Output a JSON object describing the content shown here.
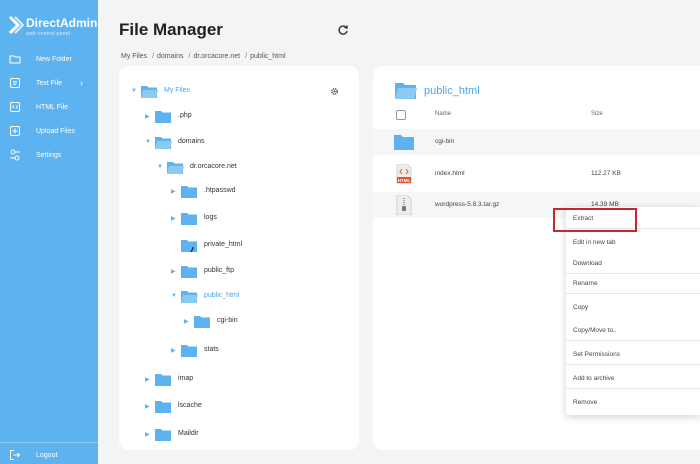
{
  "app": {
    "brand": "DirectAdmin",
    "brand_sub": "web control panel",
    "accent": "#5cb3ef"
  },
  "sidebar": {
    "items": [
      {
        "label": "New Folder",
        "icon": "folder-outline-icon"
      },
      {
        "label": "Text File",
        "icon": "text-file-icon",
        "chevron": "›"
      },
      {
        "label": "HTML File",
        "icon": "html-file-icon"
      },
      {
        "label": "Upload Files",
        "icon": "upload-icon"
      },
      {
        "label": "Settings",
        "icon": "settings-sliders-icon"
      }
    ],
    "logout": "Logout"
  },
  "header": {
    "title": "File Manager",
    "breadcrumb": [
      "My Files",
      "domains",
      "dr.orcacore.net",
      "public_html"
    ]
  },
  "tree": {
    "root": "My Files",
    "nodes": [
      {
        "name": ".php"
      },
      {
        "name": "domains"
      },
      {
        "name": "dr.orcacore.net"
      },
      {
        "name": ".htpasswd"
      },
      {
        "name": "logs"
      },
      {
        "name": "private_html"
      },
      {
        "name": "public_ftp"
      },
      {
        "name": "public_html"
      },
      {
        "name": "cgi-bin"
      },
      {
        "name": "stats"
      },
      {
        "name": "imap"
      },
      {
        "name": "lscache"
      },
      {
        "name": "Maildir"
      }
    ]
  },
  "files": {
    "title": "public_html",
    "columns": {
      "name": "Name",
      "size": "Size"
    },
    "rows": [
      {
        "name": "cgi-bin",
        "size": "",
        "type": "folder"
      },
      {
        "name": "index.html",
        "size": "112.27 KB",
        "type": "html"
      },
      {
        "name": "wordpress-5.8.3.tar.gz",
        "size": "14.39 MB",
        "type": "archive"
      }
    ]
  },
  "context_menu": {
    "items": [
      "Extract",
      "Edit in new tab",
      "Download",
      "Rename",
      "Copy",
      "Copy/Move to..",
      "Set Permissions",
      "Add to archive",
      "Remove"
    ]
  }
}
